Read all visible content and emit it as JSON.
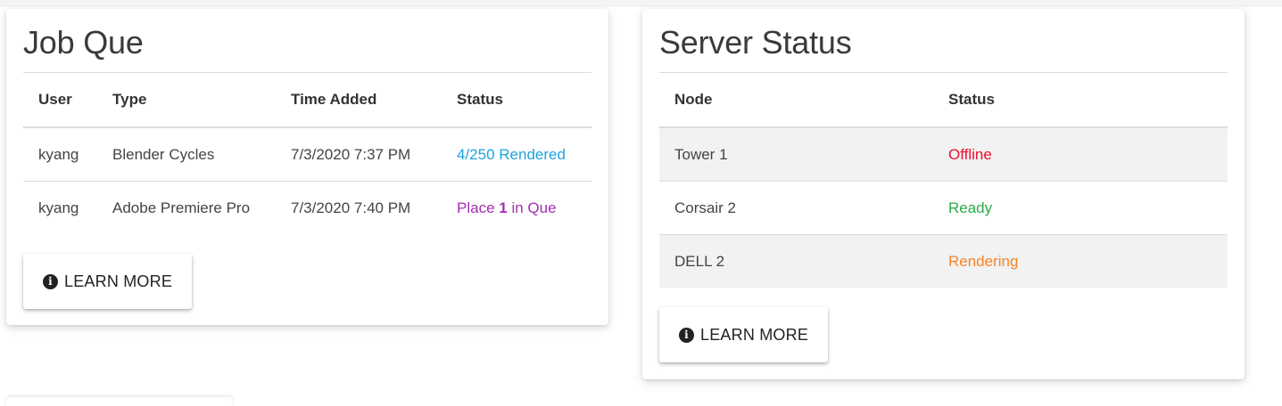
{
  "job_que": {
    "title": "Job Que",
    "columns": [
      "User",
      "Type",
      "Time Added",
      "Status"
    ],
    "rows": [
      {
        "user": "kyang",
        "type": "Blender Cycles",
        "time_added": "7/3/2020 7:37 PM",
        "status": "4/250 Rendered",
        "status_color": "#1ea3e0"
      },
      {
        "user": "kyang",
        "type": "Adobe Premiere Pro",
        "time_added": "7/3/2020 7:40 PM",
        "status_prefix": "Place ",
        "status_number": "1",
        "status_suffix": " in Que",
        "status_color": "#a22fb0"
      }
    ],
    "button_label": "LEARN MORE",
    "button_icon": "info-circle-icon"
  },
  "server_status": {
    "title": "Server Status",
    "columns": [
      "Node",
      "Status"
    ],
    "rows": [
      {
        "node": "Tower 1",
        "status": "Offline",
        "status_color": "#e8112d"
      },
      {
        "node": "Corsair 2",
        "status": "Ready",
        "status_color": "#2aaa4a"
      },
      {
        "node": "DELL 2",
        "status": "Rendering",
        "status_color": "#f5852a"
      }
    ],
    "button_label": "LEARN MORE",
    "button_icon": "info-circle-icon"
  }
}
